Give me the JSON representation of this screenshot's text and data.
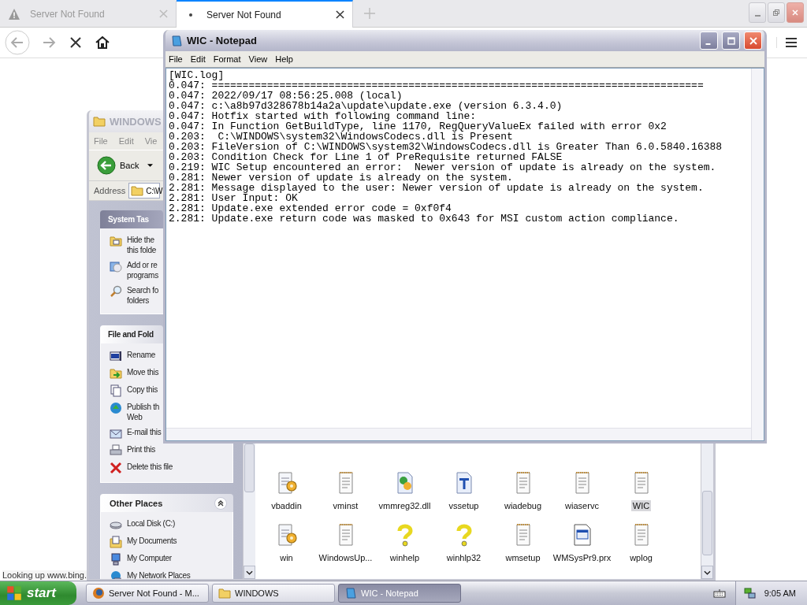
{
  "browser": {
    "tabs": [
      {
        "label": "Server Not Found",
        "selected": false,
        "kind": "warning"
      },
      {
        "label": "Server Not Found",
        "selected": true,
        "kind": "loading"
      }
    ],
    "status": "Looking up www.bing."
  },
  "explorer": {
    "title": "WINDOWS",
    "active": false,
    "menu": [
      "File",
      "Edit",
      "Vie"
    ],
    "back_label": "Back",
    "address_label": "Address",
    "address": "C:\\W",
    "panels": [
      {
        "title": "System Tas",
        "kind": "special",
        "items": [
          {
            "kind": "hide",
            "lines": [
              "Hide the",
              "this folde"
            ]
          },
          {
            "kind": "addremove",
            "lines": [
              "Add or re",
              "programs"
            ]
          },
          {
            "kind": "search",
            "lines": [
              "Search fo",
              "folders"
            ]
          }
        ]
      },
      {
        "title": "File and Fold",
        "kind": "plain",
        "items": [
          {
            "kind": "rename",
            "lines": [
              "Rename"
            ]
          },
          {
            "kind": "move",
            "lines": [
              "Move this"
            ]
          },
          {
            "kind": "copy",
            "lines": [
              "Copy this"
            ]
          },
          {
            "kind": "globe",
            "lines": [
              "Publish th",
              "Web"
            ]
          },
          {
            "kind": "email",
            "lines": [
              "E-mail this"
            ]
          },
          {
            "kind": "print",
            "lines": [
              "Print this"
            ]
          },
          {
            "kind": "delete",
            "lines": [
              "Delete this file"
            ]
          }
        ]
      },
      {
        "title": "Other Places",
        "kind": "collapsible",
        "items": [
          {
            "kind": "disk",
            "lines": [
              "Local Disk (C:)"
            ]
          },
          {
            "kind": "documents",
            "lines": [
              "My Documents"
            ]
          },
          {
            "kind": "computer",
            "lines": [
              "My Computer"
            ]
          },
          {
            "kind": "network",
            "lines": [
              "My Network Places"
            ]
          }
        ]
      }
    ],
    "files": [
      {
        "name": "vbaddin",
        "kind": "script",
        "selected": false
      },
      {
        "name": "vminst",
        "kind": "text",
        "selected": false
      },
      {
        "name": "vmmreg32.dll",
        "kind": "dll",
        "selected": false
      },
      {
        "name": "vssetup",
        "kind": "font",
        "selected": false
      },
      {
        "name": "wiadebug",
        "kind": "text",
        "selected": false
      },
      {
        "name": "wiaservc",
        "kind": "text",
        "selected": false
      },
      {
        "name": "WIC",
        "kind": "text",
        "selected": true
      },
      {
        "name": "win",
        "kind": "script",
        "selected": false
      },
      {
        "name": "WindowsUp...",
        "kind": "text",
        "selected": false
      },
      {
        "name": "winhelp",
        "kind": "help",
        "selected": false
      },
      {
        "name": "winhlp32",
        "kind": "help",
        "selected": false
      },
      {
        "name": "wmsetup",
        "kind": "text",
        "selected": false
      },
      {
        "name": "WMSysPr9.prx",
        "kind": "prx",
        "selected": false
      },
      {
        "name": "wplog",
        "kind": "text",
        "selected": false
      }
    ]
  },
  "notepad": {
    "title": "WIC - Notepad",
    "active": true,
    "menu": [
      "File",
      "Edit",
      "Format",
      "View",
      "Help"
    ],
    "lines": [
      "[WIC.log]",
      "0.047: ================================================================================",
      "0.047: 2022/09/17 08:56:25.008 (local)",
      "0.047: c:\\a8b97d328678b14a2a\\update\\update.exe (version 6.3.4.0)",
      "0.047: Hotfix started with following command line:",
      "0.047: In Function GetBuildType, line 1170, RegQueryValueEx failed with error 0x2",
      "0.203:  C:\\WINDOWS\\system32\\WindowsCodecs.dll is Present",
      "0.203: FileVersion of C:\\WINDOWS\\system32\\WindowsCodecs.dll is Greater Than 6.0.5840.16388",
      "0.203: Condition Check for Line 1 of PreRequisite returned FALSE",
      "0.219: WIC Setup encountered an error:  Newer version of update is already on the system.",
      "0.281: Newer version of update is already on the system.",
      "2.281: Message displayed to the user: Newer version of update is already on the system.",
      "2.281: User Input: OK",
      "2.281: Update.exe extended error code = 0xf0f4",
      "2.281: Update.exe return code was masked to 0x643 for MSI custom action compliance."
    ]
  },
  "taskbar": {
    "start": "start",
    "tasks": [
      {
        "label": "Server Not Found - M...",
        "kind": "browser",
        "selected": false
      },
      {
        "label": "WINDOWS",
        "kind": "folder",
        "selected": false
      },
      {
        "label": "WIC - Notepad",
        "kind": "notepad",
        "selected": true
      }
    ],
    "clock": "9:05 AM"
  }
}
